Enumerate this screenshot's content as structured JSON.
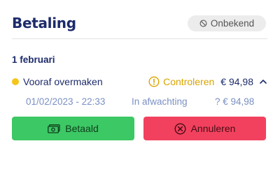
{
  "header": {
    "title": "Betaling",
    "badge_label": "Onbekend"
  },
  "payment": {
    "date_heading": "1 februari",
    "method": "Vooraf overmaken",
    "status": "Controleren",
    "amount": "€ 94,98",
    "datetime": "01/02/2023 - 22:33",
    "pending_label": "In afwachting",
    "pending_amount": "? € 94,98"
  },
  "actions": {
    "paid_label": "Betaald",
    "cancel_label": "Annuleren"
  },
  "colors": {
    "title": "#1d2b6b",
    "status_warning": "#d9a400",
    "dot": "#f5c518",
    "paid_button": "#3cc864",
    "cancel_button": "#f2415e"
  },
  "icons": {
    "badge": "ban-icon",
    "status": "warning-circle-icon",
    "toggle": "chevron-up-icon",
    "paid": "cash-icon",
    "cancel": "x-circle-icon"
  }
}
